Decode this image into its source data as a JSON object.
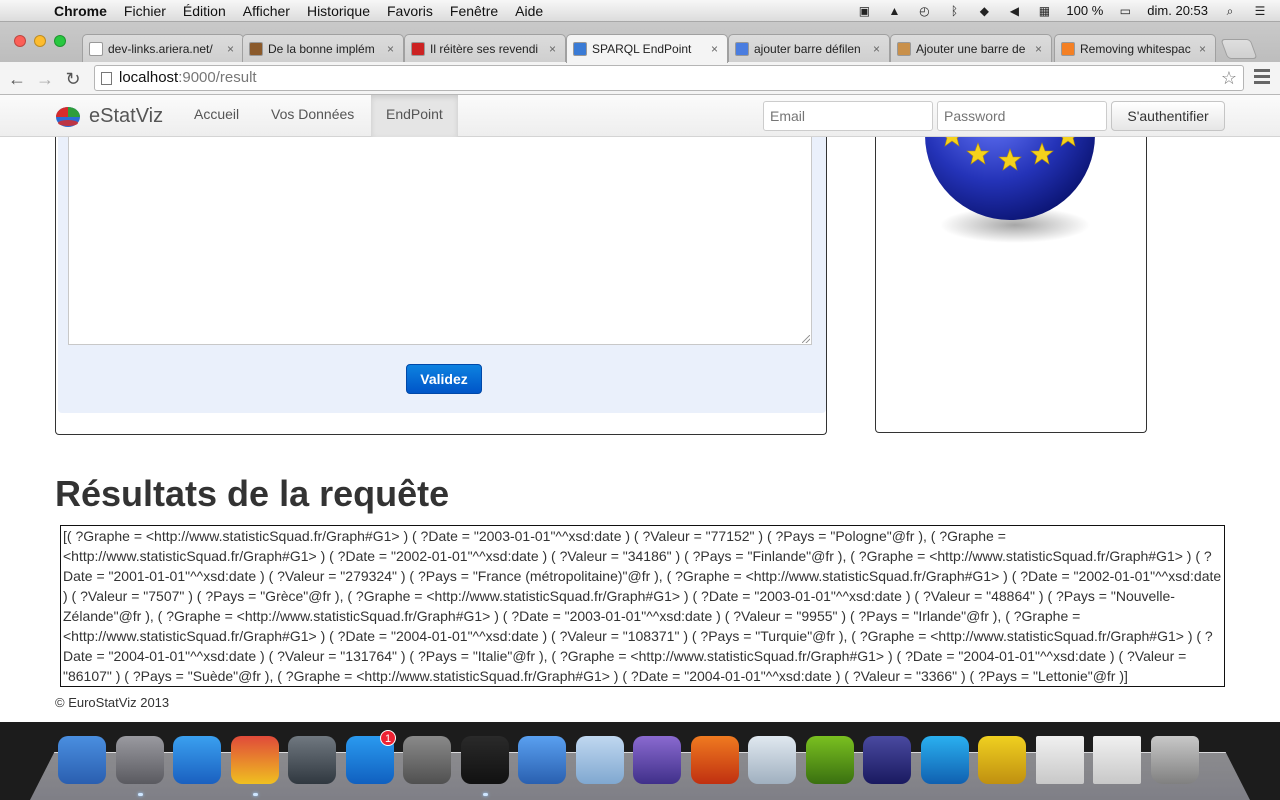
{
  "menubar": {
    "app": "Chrome",
    "menus": [
      "Fichier",
      "Édition",
      "Afficher",
      "Historique",
      "Favoris",
      "Fenêtre",
      "Aide"
    ],
    "battery": "100 %",
    "clock": "dim. 20:53"
  },
  "tabs": [
    {
      "label": "dev-links.ariera.net/",
      "favicon_color": "#ffffff"
    },
    {
      "label": "De la bonne implém",
      "favicon_color": "#8b5a2b"
    },
    {
      "label": "Il réitère ses revendi",
      "favicon_color": "#cc2222"
    },
    {
      "label": "SPARQL EndPoint",
      "favicon_color": "#3a7bd5",
      "active": true
    },
    {
      "label": "ajouter barre défilen",
      "favicon_color": "#4a7de0"
    },
    {
      "label": "Ajouter une barre de",
      "favicon_color": "#c9904a"
    },
    {
      "label": "Removing whitespac",
      "favicon_color": "#f48024"
    }
  ],
  "address": {
    "host": "localhost",
    "path": ":9000/result"
  },
  "site": {
    "brand": "eStatViz",
    "nav": [
      "Accueil",
      "Vos Données",
      "EndPoint"
    ],
    "active_nav": "EndPoint",
    "email_placeholder": "Email",
    "password_placeholder": "Password",
    "auth_button": "S'authentifier"
  },
  "query": {
    "submit_label": "Validez"
  },
  "results": {
    "title": "Résultats de la requête",
    "text": "[( ?Graphe = <http://www.statisticSquad.fr/Graph#G1> ) ( ?Date = \"2003-01-01\"^^xsd:date ) ( ?Valeur = \"77152\" ) ( ?Pays = \"Pologne\"@fr ), ( ?Graphe = <http://www.statisticSquad.fr/Graph#G1> ) ( ?Date = \"2002-01-01\"^^xsd:date ) ( ?Valeur = \"34186\" ) ( ?Pays = \"Finlande\"@fr ), ( ?Graphe = <http://www.statisticSquad.fr/Graph#G1> ) ( ?Date = \"2001-01-01\"^^xsd:date ) ( ?Valeur = \"279324\" ) ( ?Pays = \"France (métropolitaine)\"@fr ), ( ?Graphe = <http://www.statisticSquad.fr/Graph#G1> ) ( ?Date = \"2002-01-01\"^^xsd:date ) ( ?Valeur = \"7507\" ) ( ?Pays = \"Grèce\"@fr ), ( ?Graphe = <http://www.statisticSquad.fr/Graph#G1> ) ( ?Date = \"2003-01-01\"^^xsd:date ) ( ?Valeur = \"48864\" ) ( ?Pays = \"Nouvelle-Zélande\"@fr ), ( ?Graphe = <http://www.statisticSquad.fr/Graph#G1> ) ( ?Date = \"2003-01-01\"^^xsd:date ) ( ?Valeur = \"9955\" ) ( ?Pays = \"Irlande\"@fr ), ( ?Graphe = <http://www.statisticSquad.fr/Graph#G1> ) ( ?Date = \"2004-01-01\"^^xsd:date ) ( ?Valeur = \"108371\" ) ( ?Pays = \"Turquie\"@fr ), ( ?Graphe = <http://www.statisticSquad.fr/Graph#G1> ) ( ?Date = \"2004-01-01\"^^xsd:date ) ( ?Valeur = \"131764\" ) ( ?Pays = \"Italie\"@fr ), ( ?Graphe = <http://www.statisticSquad.fr/Graph#G1> ) ( ?Date = \"2004-01-01\"^^xsd:date ) ( ?Valeur = \"86107\" ) ( ?Pays = \"Suède\"@fr ), ( ?Graphe = <http://www.statisticSquad.fr/Graph#G1> ) ( ?Date = \"2004-01-01\"^^xsd:date ) ( ?Valeur = \"3366\" ) ( ?Pays = \"Lettonie\"@fr )]"
  },
  "footer": "© EuroStatViz 2013",
  "dock": {
    "apps": [
      "finder-icon",
      "launchpad-icon",
      "safari-icon",
      "chrome-icon",
      "facetime-icon",
      "app-store-icon",
      "system-preferences-icon",
      "terminal-icon",
      "xcode-icon",
      "virtualbox-icon",
      "eclipse-icon",
      "firefox-icon",
      "preview-icon",
      "brackets-icon",
      "eclipse-alt-icon",
      "webstorm-icon",
      "wampserver-icon",
      "documents-stack-icon",
      "downloads-stack-icon",
      "trash-icon"
    ],
    "app_store_badge": "1"
  }
}
